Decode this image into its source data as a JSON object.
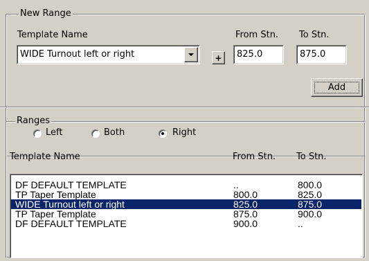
{
  "new_range": {
    "group_title": "New Range",
    "template_name_label": "Template Name",
    "from_label": "From Stn.",
    "to_label": "To Stn.",
    "template_value": "WIDE Turnout left or right",
    "plus_label": "+",
    "from_value": "825.0",
    "to_value": "875.0",
    "add_label": "Add"
  },
  "ranges": {
    "group_title": "Ranges",
    "radio_left": "Left",
    "radio_both": "Both",
    "radio_right": "Right",
    "selected_side": "Right",
    "columns": [
      "Template Name",
      "From Stn.",
      "To Stn."
    ],
    "rows": [
      {
        "name": "DF DEFAULT TEMPLATE",
        "from": "..",
        "to": "800.0"
      },
      {
        "name": "TP Taper Template",
        "from": "800.0",
        "to": "825.0"
      },
      {
        "name": "WIDE Turnout left or right",
        "from": "825.0",
        "to": "875.0"
      },
      {
        "name": "TP Taper Template",
        "from": "875.0",
        "to": "900.0"
      },
      {
        "name": "DF DEFAULT TEMPLATE",
        "from": "900.0",
        "to": ".."
      }
    ],
    "selected_row": 2
  },
  "colors": {
    "face": "#d4d0c8",
    "selection": "#0a246a"
  }
}
